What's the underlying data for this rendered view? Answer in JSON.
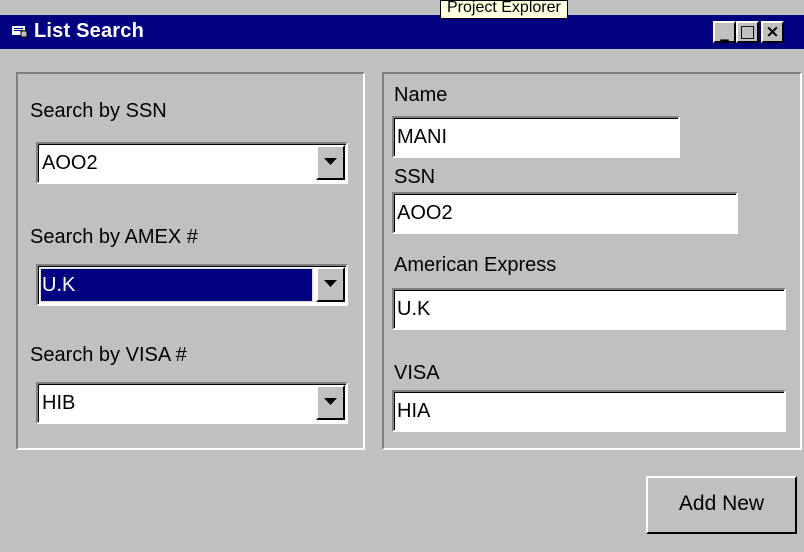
{
  "window": {
    "title": "List Search",
    "tooltip": "Project Explorer",
    "controls": {
      "minimize": "_",
      "maximize": "□",
      "close": "×"
    }
  },
  "left_panel": {
    "ssn_label": "Search by SSN",
    "ssn_value": "AOO2",
    "amex_label": "Search by AMEX #",
    "amex_value": "U.K",
    "visa_label": "Search by VISA #",
    "visa_value": "HIB"
  },
  "right_panel": {
    "name_label": "Name",
    "name_value": "MANI",
    "ssn_label": "SSN",
    "ssn_value": "AOO2",
    "amex_label": "American Express",
    "amex_value": "U.K",
    "visa_label": "VISA",
    "visa_value": "HIA"
  },
  "buttons": {
    "add_new": "Add New"
  },
  "colors": {
    "titlebar": "#000080",
    "face": "#c0c0c0",
    "selection": "#000080"
  }
}
